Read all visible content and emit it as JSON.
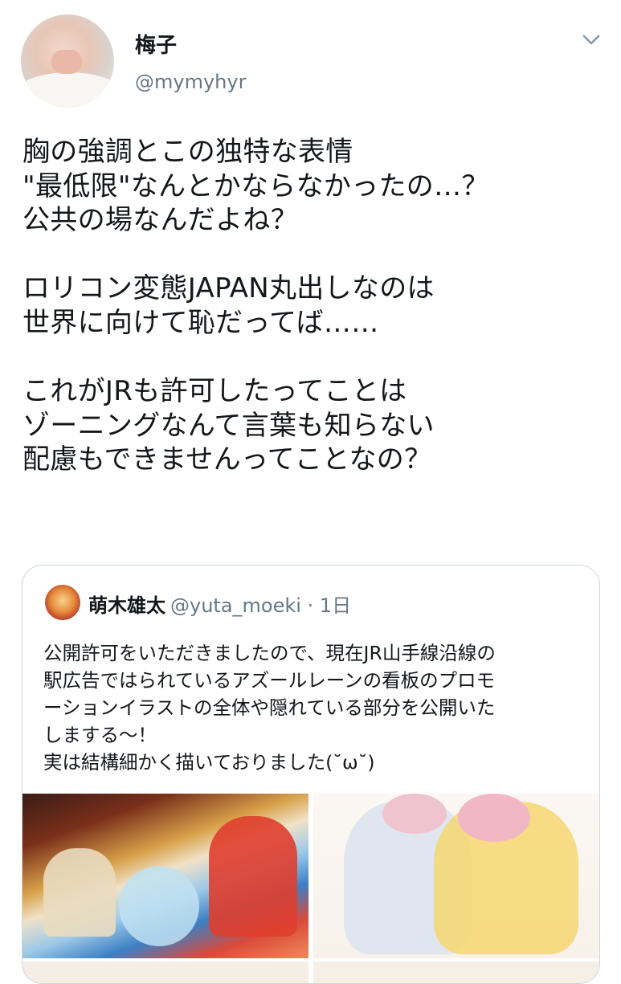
{
  "tweet": {
    "author_name": "梅子",
    "author_handle": "@mymyhyr",
    "text": "胸の強調とこの独特な表情\n\"最低限\"なんとかならなかったの…？\n公共の場なんだよね？\n\nロリコン変態JAPAN丸出しなのは\n世界に向けて恥だってば……\n\nこれがJRも許可したってことは\nゾーニングなんて言葉も知らない\n配慮もできませんってことなの？"
  },
  "quoted": {
    "author_name": "萌木雄太",
    "meta": "@yuta_moeki · 1日",
    "text": "公開許可をいただきましたので、現在JR山手線沿線の\n駅広告ではられているアズールレーンの看板のプロモ\nーションイラストの全体や隠れている部分を公開いた\nしまする～！\n実は結構細かく描いておりました(˘ω˘)"
  },
  "icons": {
    "menu": "chevron-down-icon"
  }
}
